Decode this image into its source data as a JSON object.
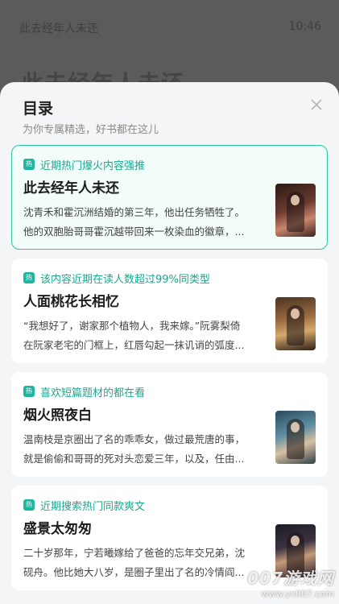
{
  "background": {
    "title": "此去经年人未还",
    "time": "10:46",
    "big_title": "此去经年人未还"
  },
  "sheet": {
    "title": "目录",
    "subtitle": "为你专属精选，好书都在这儿",
    "close_icon": "close-icon",
    "hot_badge": "热",
    "books": [
      {
        "tag": "近期热门爆火内容强推",
        "title": "此去经年人未还",
        "desc_line1": "沈青禾和霍沉洲结婚的第三年，他出任务牺牲了。",
        "desc_line2": "他的双胞胎哥哥霍沉越带回来一枚染血的徽章，..."
      },
      {
        "tag": "该内容近期在读人数超过99%同类型",
        "title": "人面桃花长相忆",
        "desc_line1": "“我想好了，谢家那个植物人，我来嫁。”阮雾梨倚",
        "desc_line2": "在阮家老宅的门框上，红唇勾起一抹讥诮的弧度..."
      },
      {
        "tag": "喜欢短篇题材的都在看",
        "title": "烟火照夜白",
        "desc_line1": "温南枝是京圈出了名的乖乖女，做过最荒唐的事，",
        "desc_line2": "就是偷偷和哥哥的死对头恋爱三年，以及，任由..."
      },
      {
        "tag": "近期搜索热门同款爽文",
        "title": "盛景太匆匆",
        "desc_line1": "二十岁那年，宁若曦嫁给了爸爸的忘年交兄弟，沈",
        "desc_line2": "砚舟。他比她大八岁，是圈子里出了名的冷情阎..."
      }
    ]
  },
  "watermark": {
    "main": "007游戏网",
    "url": "www.yx007.com"
  },
  "colors": {
    "accent": "#1fb6a0",
    "active_border": "#2fc4a0"
  }
}
